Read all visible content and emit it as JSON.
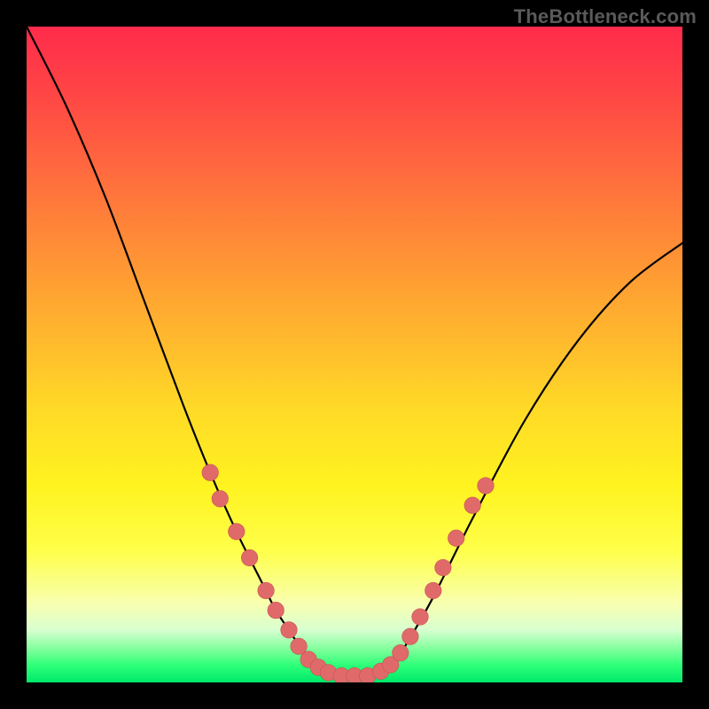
{
  "watermark": "TheBottleneck.com",
  "colors": {
    "frame": "#000000",
    "curve": "#000000",
    "bead_fill": "#e06a6a",
    "bead_stroke": "#c94f4f"
  },
  "chart_data": {
    "type": "line",
    "title": "",
    "xlabel": "",
    "ylabel": "",
    "xlim": [
      0,
      100
    ],
    "ylim": [
      0,
      100
    ],
    "grid": false,
    "legend": false,
    "series": [
      {
        "name": "bottleneck-curve",
        "x": [
          0,
          6,
          12,
          18,
          24,
          28,
          32,
          36,
          38,
          40,
          42,
          44,
          46,
          48,
          50,
          52,
          54,
          56,
          58,
          62,
          68,
          76,
          84,
          92,
          100
        ],
        "values": [
          100,
          88,
          74,
          58,
          42,
          32,
          23,
          15,
          11,
          8,
          5,
          3,
          1.8,
          1,
          1,
          1,
          1.8,
          3,
          6,
          13,
          25,
          40,
          52,
          61,
          67
        ]
      }
    ],
    "markers": {
      "name": "beads",
      "points": [
        {
          "x": 28.0,
          "y": 32.0
        },
        {
          "x": 29.5,
          "y": 28.0
        },
        {
          "x": 32.0,
          "y": 23.0
        },
        {
          "x": 34.0,
          "y": 19.0
        },
        {
          "x": 36.5,
          "y": 14.0
        },
        {
          "x": 38.0,
          "y": 11.0
        },
        {
          "x": 40.0,
          "y": 8.0
        },
        {
          "x": 41.5,
          "y": 5.5
        },
        {
          "x": 43.0,
          "y": 3.5
        },
        {
          "x": 44.5,
          "y": 2.3
        },
        {
          "x": 46.0,
          "y": 1.5
        },
        {
          "x": 48.0,
          "y": 1.0
        },
        {
          "x": 50.0,
          "y": 1.0
        },
        {
          "x": 52.0,
          "y": 1.0
        },
        {
          "x": 54.0,
          "y": 1.7
        },
        {
          "x": 55.5,
          "y": 2.7
        },
        {
          "x": 57.0,
          "y": 4.5
        },
        {
          "x": 58.5,
          "y": 7.0
        },
        {
          "x": 60.0,
          "y": 10.0
        },
        {
          "x": 62.0,
          "y": 14.0
        },
        {
          "x": 63.5,
          "y": 17.5
        },
        {
          "x": 65.5,
          "y": 22.0
        },
        {
          "x": 68.0,
          "y": 27.0
        },
        {
          "x": 70.0,
          "y": 30.0
        }
      ]
    }
  }
}
